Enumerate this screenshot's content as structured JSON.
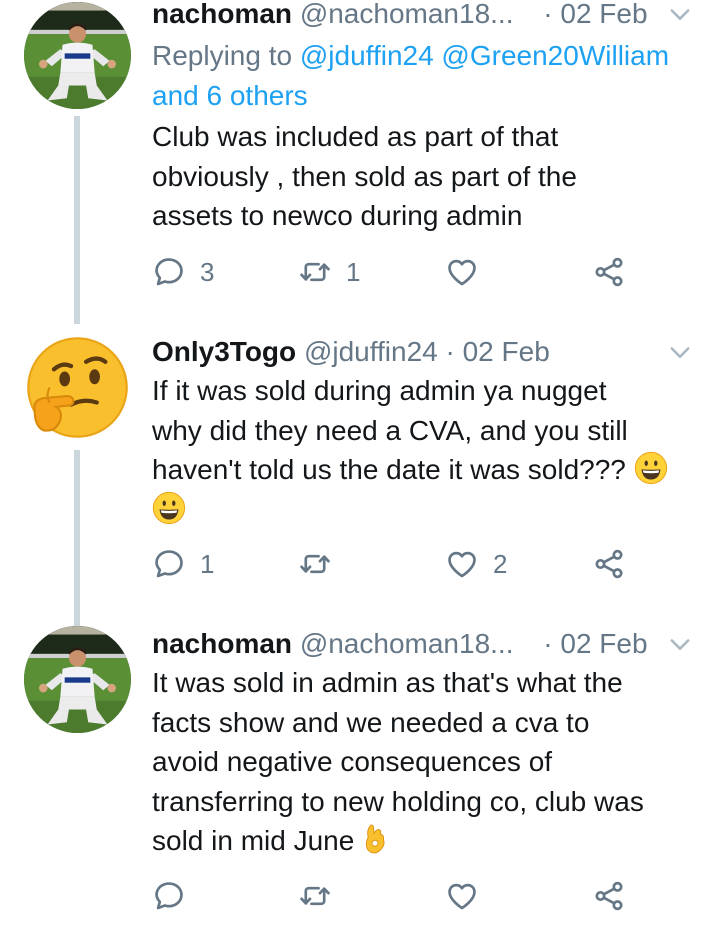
{
  "colors": {
    "text": "#14171a",
    "secondary": "#657786",
    "link": "#1da1f2",
    "thread_line": "#ccd6dd"
  },
  "tweets": [
    {
      "name": "nachoman",
      "handle": "@nachoman18...",
      "separator": "·",
      "date": "02 Feb",
      "reply_prefix": "Replying to",
      "reply_mentions": "@jduffin24 @Green20William",
      "reply_suffix": "and 6 others",
      "lines": [
        "Club was included as part of that",
        "obviously , then sold as part of the",
        "assets to newco during admin"
      ],
      "reply_count": "3",
      "retweet_count": "1",
      "like_count": "",
      "avatar": "footballer-photo"
    },
    {
      "name": "Only3Togo",
      "handle": "@jduffin24",
      "separator": "·",
      "date": "02 Feb",
      "lines": [
        "If it was sold during admin ya nugget",
        "why did they need a CVA, and you still",
        "haven't told us the date it was sold???"
      ],
      "emoji": "grinning-face-emoji",
      "reply_count": "1",
      "retweet_count": "",
      "like_count": "2",
      "avatar": "thinking-face-emoji"
    },
    {
      "name": "nachoman",
      "handle": "@nachoman18...",
      "separator": "·",
      "date": "02 Feb",
      "lines": [
        "It was sold in admin as that's what the",
        "facts show and we needed a cva to",
        "avoid negative consequences of",
        "transferring to new holding co, club was",
        "sold in mid June"
      ],
      "emoji": "ok-hand-emoji",
      "reply_count": "",
      "retweet_count": "",
      "like_count": "",
      "avatar": "footballer-photo"
    }
  ]
}
